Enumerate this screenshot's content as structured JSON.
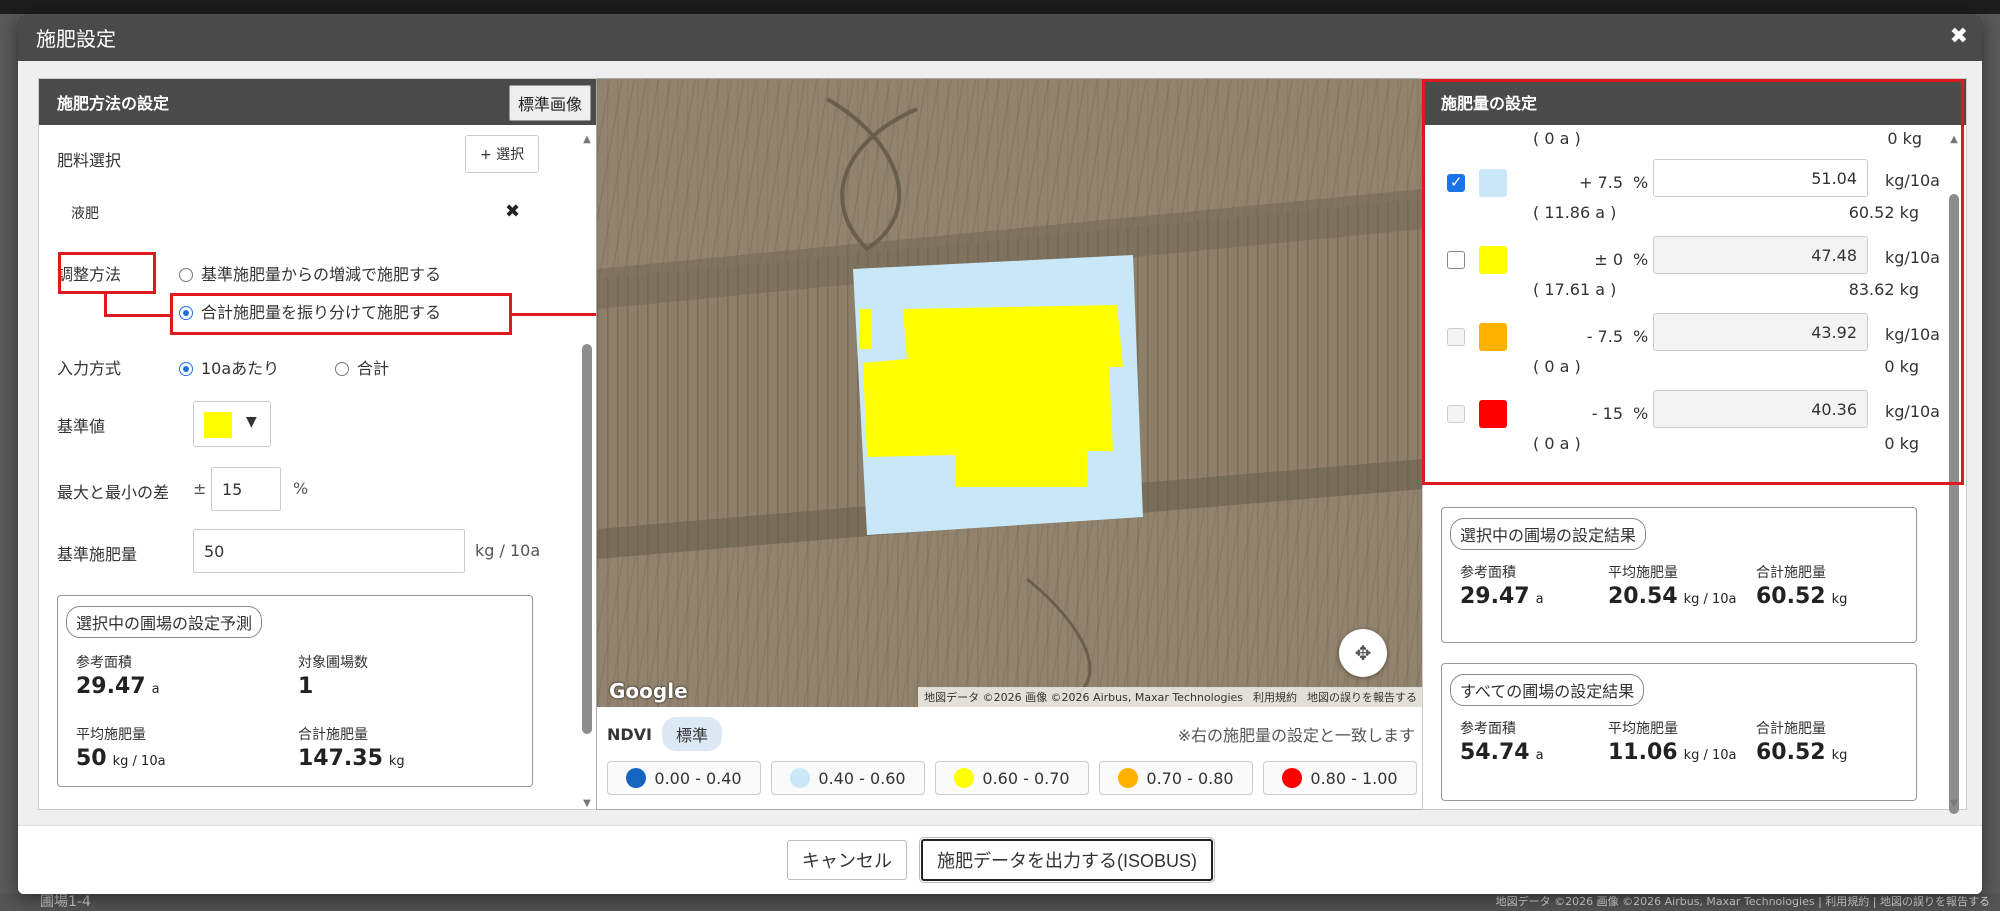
{
  "dialog": {
    "title": "施肥設定",
    "close_icon": "close-icon",
    "cancel_label": "キャンセル",
    "export_label": "施肥データを出力する(ISOBUS)"
  },
  "left": {
    "header": "施肥方法の設定",
    "standard_image_button": "標準画像",
    "fertilizer_select_label": "肥料選択",
    "select_button": "+ 選択",
    "fertilizer_name": "液肥",
    "adjust_method_label": "調整方法",
    "adjust_option_1": "基準施肥量からの増減で施肥する",
    "adjust_option_2": "合計施肥量を振り分けて施肥する",
    "input_method_label": "入力方式",
    "input_option_1": "10aあたり",
    "input_option_2": "合計",
    "reference_label": "基準値",
    "reference_color": "#ffff00",
    "maxmin_label": "最大と最小の差",
    "plusminus": "±",
    "maxmin_value": "15",
    "percent": "%",
    "base_amount_label": "基準施肥量",
    "base_amount_value": "50",
    "base_amount_unit": "kg / 10a",
    "prediction": {
      "title": "選択中の圃場の設定予測",
      "area_label": "参考面積",
      "area_value": "29.47",
      "area_unit": "a",
      "count_label": "対象圃場数",
      "count_value": "1",
      "avg_label": "平均施肥量",
      "avg_value": "50",
      "avg_unit": "kg / 10a",
      "total_label": "合計施肥量",
      "total_value": "147.35",
      "total_unit": "kg"
    }
  },
  "map": {
    "google": "Google",
    "attribution": "地図データ ©2026 画像 ©2026 Airbus, Maxar Technologies",
    "terms": "利用規約",
    "report": "地図の誤りを報告する",
    "ndvi_label": "NDVI",
    "standard_chip": "標準",
    "note": "※右の施肥量の設定と一致します",
    "legend": [
      {
        "label": "0.00 - 0.40",
        "color": "#1565c0"
      },
      {
        "label": "0.40 - 0.60",
        "color": "#c8e8f8"
      },
      {
        "label": "0.60 - 0.70",
        "color": "#ffff00"
      },
      {
        "label": "0.70 - 0.80",
        "color": "#ffb300"
      },
      {
        "label": "0.80 - 1.00",
        "color": "#ff0000"
      }
    ]
  },
  "right": {
    "header": "施肥量の設定",
    "top_area": "( 0 a )",
    "top_kg": "0 kg",
    "rows": [
      {
        "color": "#c8e8f8",
        "pct": "+ 7.5",
        "area": "( 11.86 a )",
        "amount": "51.04",
        "kg": "60.52 kg"
      },
      {
        "color": "#ffff00",
        "pct": "± 0",
        "area": "( 17.61 a )",
        "amount": "47.48",
        "kg": "83.62 kg"
      },
      {
        "color": "#ffb300",
        "pct": "- 7.5",
        "area": "( 0 a )",
        "amount": "43.92",
        "kg": "0 kg"
      },
      {
        "color": "#ff0000",
        "pct": "- 15",
        "area": "( 0 a )",
        "amount": "40.36",
        "kg": "0 kg"
      }
    ],
    "pct_sign": "%",
    "unit": "kg/10a",
    "selected_result": {
      "title": "選択中の圃場の設定結果",
      "area_label": "参考面積",
      "area_value": "29.47",
      "area_unit": "a",
      "avg_label": "平均施肥量",
      "avg_value": "20.54",
      "avg_unit": "kg / 10a",
      "total_label": "合計施肥量",
      "total_value": "60.52",
      "total_unit": "kg"
    },
    "all_result": {
      "title": "すべての圃場の設定結果",
      "area_label": "参考面積",
      "area_value": "54.74",
      "area_unit": "a",
      "avg_label": "平均施肥量",
      "avg_value": "11.06",
      "avg_unit": "kg / 10a",
      "total_label": "合計施肥量",
      "total_value": "60.52",
      "total_unit": "kg"
    }
  },
  "background": {
    "field_label": "圃場1-4",
    "map_attribution": "地図データ ©2026 画像 ©2026 Airbus, Maxar Technologies | 利用規約 | 地図の誤りを報告する"
  }
}
